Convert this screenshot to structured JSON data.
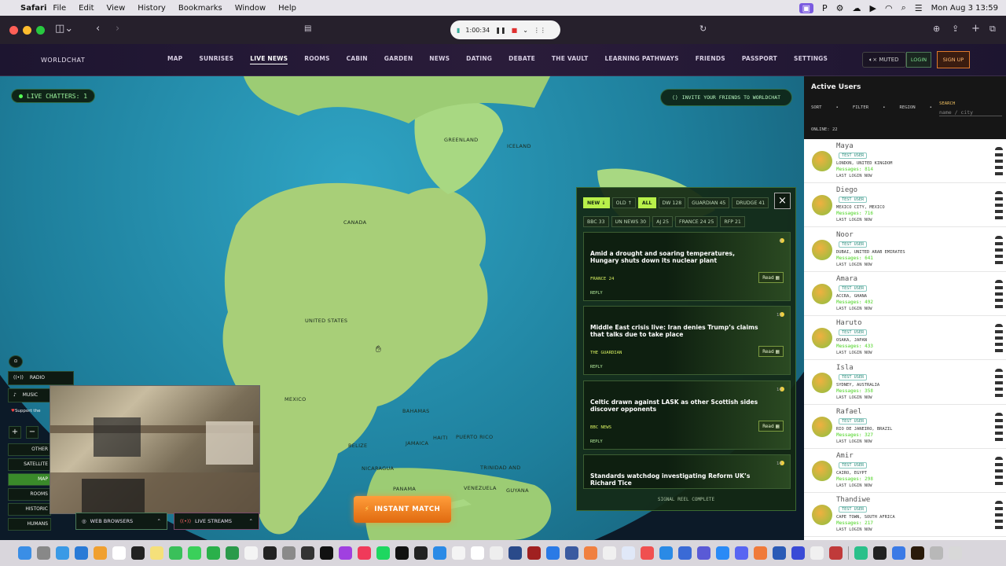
{
  "menubar": {
    "app": "Safari",
    "items": [
      "File",
      "Edit",
      "View",
      "History",
      "Bookmarks",
      "Window",
      "Help"
    ],
    "datetime": "Mon Aug 3  13:59"
  },
  "recording": {
    "timer": "1:00:34"
  },
  "site": {
    "brand": "WORLDCHAT",
    "nav": [
      "MAP",
      "SUNRISES",
      "LIVE NEWS",
      "ROOMS",
      "CABIN",
      "GARDEN",
      "NEWS",
      "DATING",
      "DEBATE",
      "THE VAULT",
      "LEARNING PATHWAYS",
      "FRIENDS",
      "PASSPORT",
      "SETTINGS"
    ],
    "active_nav": "LIVE NEWS",
    "muted": "MUTED",
    "login": "LOGIN",
    "signup": "SIGN UP"
  },
  "map": {
    "live_chatters": "LIVE CHATTERS: 1",
    "invite": "INVITE YOUR FRIENDS TO WORLDCHAT",
    "labels": [
      "GREENLAND",
      "ICELAND",
      "CANADA",
      "UNITED STATES",
      "MEXICO",
      "BAHAMAS",
      "HAITI",
      "PUERTO RICO",
      "JAMAICA",
      "BELIZE",
      "NICARAGUA",
      "PANAMA",
      "VENEZUELA",
      "GUYANA",
      "TRINIDAD AND"
    ],
    "instant_match": "INSTANT MATCH"
  },
  "news": {
    "filters_row1": [
      "NEW ↓",
      "OLD ↑",
      "ALL",
      "DW 128",
      "GUARDIAN 45",
      "DRUDGE 41"
    ],
    "filters_row2": [
      "BBC 33",
      "UN NEWS 30",
      "AJ 25",
      "FRANCE 24 25",
      "RFP 21"
    ],
    "cards": [
      {
        "title": "Amid a drought and soaring temperatures, Hungary shuts down its nuclear plant",
        "source": "FRANCE 24",
        "num": "4",
        "read": "Read",
        "reply": "REPLY"
      },
      {
        "title": "Middle East crisis live: Iran denies Trump’s claims that talks due to take place",
        "source": "THE GUARDIAN",
        "num": "11",
        "read": "Read",
        "reply": "REPLY"
      },
      {
        "title": "Celtic drawn against LASK as other Scottish sides discover opponents",
        "source": "BBC NEWS",
        "num": "14",
        "read": "Read",
        "reply": "REPLY"
      },
      {
        "title": "Standards watchdog investigating Reform UK’s Richard Tice",
        "source": "",
        "num": "14",
        "read": "",
        "reply": ""
      }
    ],
    "reel_end": "SIGNAL REEL COMPLETE"
  },
  "users": {
    "title": "Active Users",
    "sort": "SORT",
    "filter": "FILTER",
    "region": "REGION",
    "search_label": "SEARCH",
    "search_placeholder": "name / city",
    "online": "ONLINE: 22",
    "list": [
      {
        "name": "Maya",
        "tag": "TEST USER",
        "loc": "LONDON, UNITED KINGDOM",
        "msgs": "Messages: 814",
        "last": "LAST LOGIN NOW"
      },
      {
        "name": "Diego",
        "tag": "TEST USER",
        "loc": "MEXICO CITY, MEXICO",
        "msgs": "Messages: 716",
        "last": "LAST LOGIN NOW"
      },
      {
        "name": "Noor",
        "tag": "TEST USER",
        "loc": "DUBAI, UNITED ARAB EMIRATES",
        "msgs": "Messages: 641",
        "last": "LAST LOGIN NOW"
      },
      {
        "name": "Amara",
        "tag": "TEST USER",
        "loc": "ACCRA, GHANA",
        "msgs": "Messages: 492",
        "last": "LAST LOGIN NOW"
      },
      {
        "name": "Haruto",
        "tag": "TEST USER",
        "loc": "OSAKA, JAPAN",
        "msgs": "Messages: 433",
        "last": "LAST LOGIN NOW"
      },
      {
        "name": "Isla",
        "tag": "TEST USER",
        "loc": "SYDNEY, AUSTRALIA",
        "msgs": "Messages: 358",
        "last": "LAST LOGIN NOW"
      },
      {
        "name": "Rafael",
        "tag": "TEST USER",
        "loc": "RIO DE JANEIRO, BRAZIL",
        "msgs": "Messages: 327",
        "last": "LAST LOGIN NOW"
      },
      {
        "name": "Amir",
        "tag": "TEST USER",
        "loc": "CAIRO, EGYPT",
        "msgs": "Messages: 298",
        "last": "LAST LOGIN NOW"
      },
      {
        "name": "Thandiwe",
        "tag": "TEST USER",
        "loc": "CAPE TOWN, SOUTH AFRICA",
        "msgs": "Messages: 217",
        "last": "LAST LOGIN NOW"
      }
    ]
  },
  "left_tools": {
    "radio": "RADIO",
    "music": "MUSIC",
    "support": "Support the",
    "layers": [
      "OTHER",
      "SATELLITE",
      "MAP",
      "ROOMS",
      "HISTORIC",
      "HUMANS"
    ],
    "zoom_in": "+",
    "zoom_out": "−"
  },
  "bottom": {
    "browsers": "WEB BROWSERS",
    "streams": "LIVE STREAMS"
  }
}
